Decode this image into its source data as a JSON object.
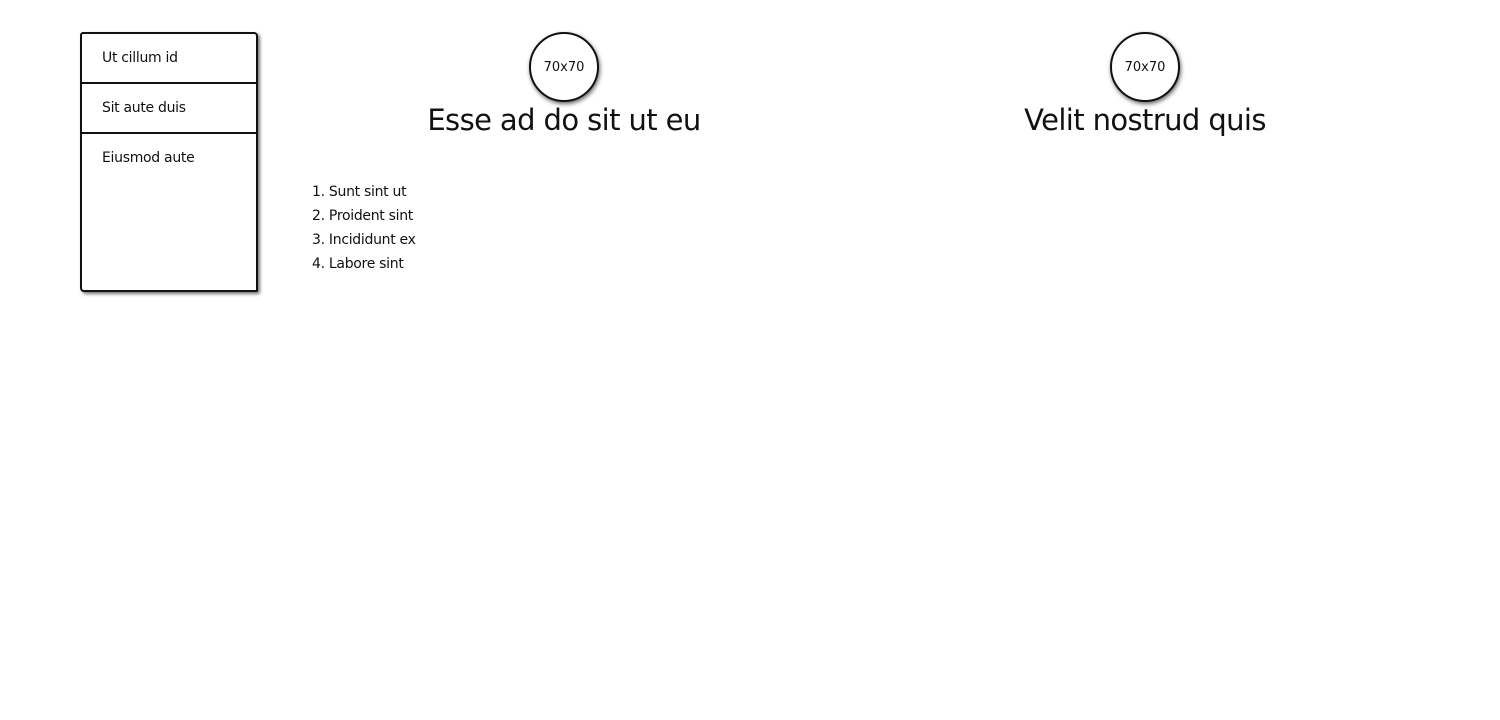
{
  "sidebar": {
    "items": [
      {
        "label": "Ut cillum id"
      },
      {
        "label": "Sit aute duis"
      },
      {
        "label": "Eiusmod aute"
      }
    ]
  },
  "cards": [
    {
      "image_label": "70x70",
      "title": "Esse ad do sit ut eu"
    },
    {
      "image_label": "70x70",
      "title": "Velit nostrud quis"
    }
  ],
  "list": {
    "items": [
      {
        "number": "1.",
        "text": "Sunt sint ut"
      },
      {
        "number": "2.",
        "text": "Proident sint"
      },
      {
        "number": "3.",
        "text": "Incididunt ex"
      },
      {
        "number": "4.",
        "text": "Labore sint"
      }
    ]
  }
}
